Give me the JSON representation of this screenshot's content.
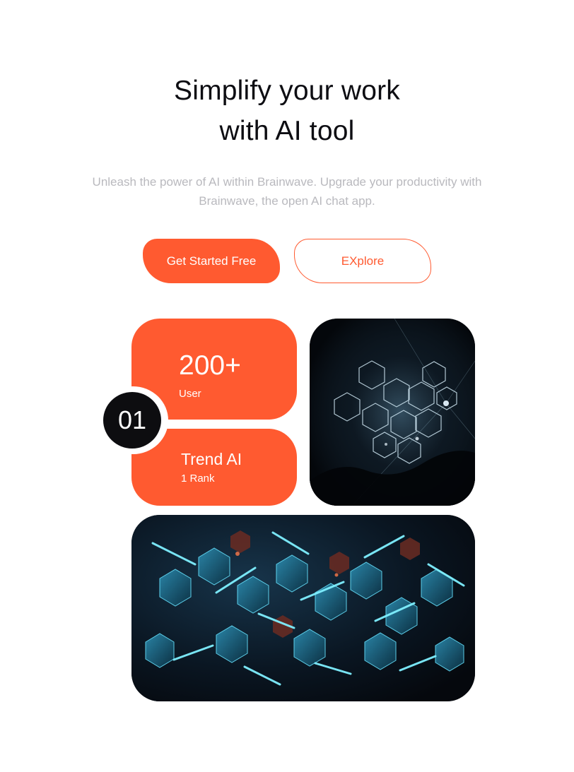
{
  "hero": {
    "title_line1": "Simplify your work",
    "title_line2": "with AI tool",
    "subtitle_line1": "Unleash the power of AI within Brainwave. Upgrade your productivity with",
    "subtitle_line2": "Brainwave, the open AI chat app."
  },
  "buttons": {
    "primary_label": "Get Started Free",
    "secondary_label": "EXplore"
  },
  "stats": {
    "users_value": "200+",
    "users_label": "User",
    "rank_value": "Trend AI",
    "rank_label": "1 Rank",
    "badge": "01"
  },
  "colors": {
    "accent": "#ff5a30",
    "dark": "#0d0d10",
    "muted_text": "#b9b9be",
    "image_bg": "#05080d",
    "neon": "#3fd9ff"
  }
}
